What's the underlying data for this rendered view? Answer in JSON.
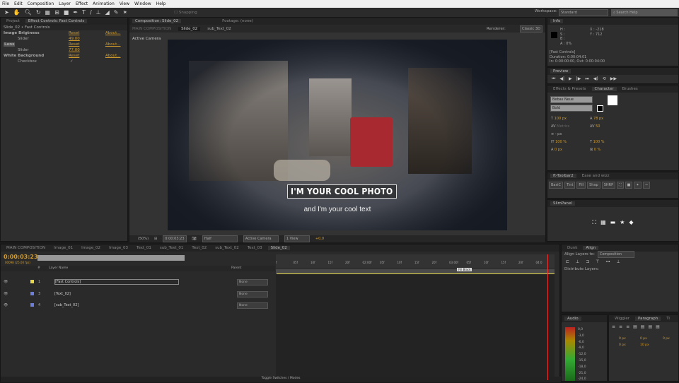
{
  "menu": [
    "File",
    "Edit",
    "Composition",
    "Layer",
    "Effect",
    "Animation",
    "View",
    "Window",
    "Help"
  ],
  "toolbar": {
    "snapping": "Snapping",
    "workspace_label": "Workspace:",
    "workspace": "Standard",
    "search_placeholder": "Search Help"
  },
  "effect_controls": {
    "tab_project": "Project",
    "tab": "Effect Controls: Fast Controls",
    "breadcrumb": "Slide_02 • Fast Controls",
    "effects": [
      {
        "name": "Image Brigtness",
        "reset": "Reset",
        "about": "About...",
        "param": "Slider",
        "value": "49,00"
      },
      {
        "name": "Lens",
        "reset": "Reset",
        "about": "About...",
        "param": "Slider",
        "value": "77,00"
      },
      {
        "name": "White Background",
        "reset": "Reset",
        "about": "About...",
        "param": "Checkbox",
        "value": "✓"
      }
    ]
  },
  "composition": {
    "tab": "Composition: Slide_02",
    "footage_tab": "Footage: (none)",
    "crumbs": [
      "MAIN COMPOSITION",
      "Slide_02",
      "sub_Text_02"
    ],
    "renderer_label": "Renderer:",
    "renderer": "Classic 3D",
    "camera_label": "Active Camera",
    "title_text": "I'M YOUR COOL PHOTO",
    "sub_text": "and I'm your cool text",
    "footer": {
      "zoom": "(50%)",
      "timecode": "0:00:03:23",
      "resolution": "Half",
      "camera": "Active Camera",
      "view": "1 View",
      "exposure": "+0,0"
    }
  },
  "info": {
    "tab": "Info",
    "h": "H :",
    "s": "S :",
    "b": "B :",
    "a": "A : 0%",
    "x": "X : -218",
    "y": "Y : 712",
    "layer": "[Fast Controls]",
    "duration": "Duration: 0:00:04:01",
    "inout": "In: 0:00:00:00, Out: 0:00:04:00"
  },
  "preview": {
    "tab": "Preview"
  },
  "character": {
    "tabs": [
      "Effects & Presets",
      "Character",
      "Brushes"
    ],
    "font": "Bebas Neue",
    "style": "Bold",
    "size": "100 px",
    "leading": "78 px",
    "kerning": "Metrics",
    "tracking": "50",
    "stroke": "- px",
    "vscale": "100 %",
    "hscale": "100 %",
    "baseline": "0 px",
    "tsume": "0 %"
  },
  "ft_toolbar": {
    "tabs": [
      "ft-Toolbar2",
      "Ease and wizz"
    ],
    "buttons": [
      "BasiC",
      "Tint",
      "Fill",
      "Shap",
      "SHRP"
    ]
  },
  "slim_panel": {
    "tab": "SlimPanel"
  },
  "timeline": {
    "tabs": [
      "MAIN COMPOSITION",
      "Image_01",
      "Image_02",
      "Image_03",
      "Text_01",
      "sub_Text_01",
      "Text_02",
      "sub_Text_02",
      "Text_03",
      "Slide_02"
    ],
    "timecode": "0:00:03:23",
    "frames": "00098 (25.00 fps)",
    "col_layer": "Layer Name",
    "col_parent": "Parent",
    "col_num": "#",
    "layers": [
      {
        "num": "1",
        "name": "[Fast Controls]",
        "color": "#e6d84a",
        "parent": "None"
      },
      {
        "num": "3",
        "name": "[Text_02]",
        "color": "#6c7ed8",
        "parent": "None"
      },
      {
        "num": "4",
        "name": "[sub_Text_02]",
        "color": "#6c7ed8",
        "parent": "None"
      }
    ],
    "ruler": [
      "f",
      "05f",
      "10f",
      "15f",
      "20f",
      "02:00f",
      "05f",
      "10f",
      "15f",
      "20f",
      "03:00f",
      "05f",
      "10f",
      "15f",
      "20f",
      "04:0"
    ],
    "marker": "Fill Black",
    "toggle": "Toggle Switches / Modes",
    "playhead_fraction": 0.975
  },
  "align": {
    "tabs": [
      "Dunk",
      "Align"
    ],
    "align_to_label": "Align Layers to:",
    "align_to": "Composition",
    "distribute": "Distribute Layers:"
  },
  "audio": {
    "tab": "Audio",
    "levels": [
      "0,0",
      "-3,0",
      "-6,0",
      "-9,0",
      "-12,0",
      "-15,0",
      "-18,0",
      "-21,0",
      "-24,0"
    ]
  },
  "paragraph": {
    "tabs": [
      "Wiggler",
      "Paragraph",
      "Ti"
    ],
    "indent_left": "0 px",
    "indent_first": "0 px",
    "indent_right": "0 px",
    "space_before": "0 px",
    "space_after": "10 px"
  }
}
